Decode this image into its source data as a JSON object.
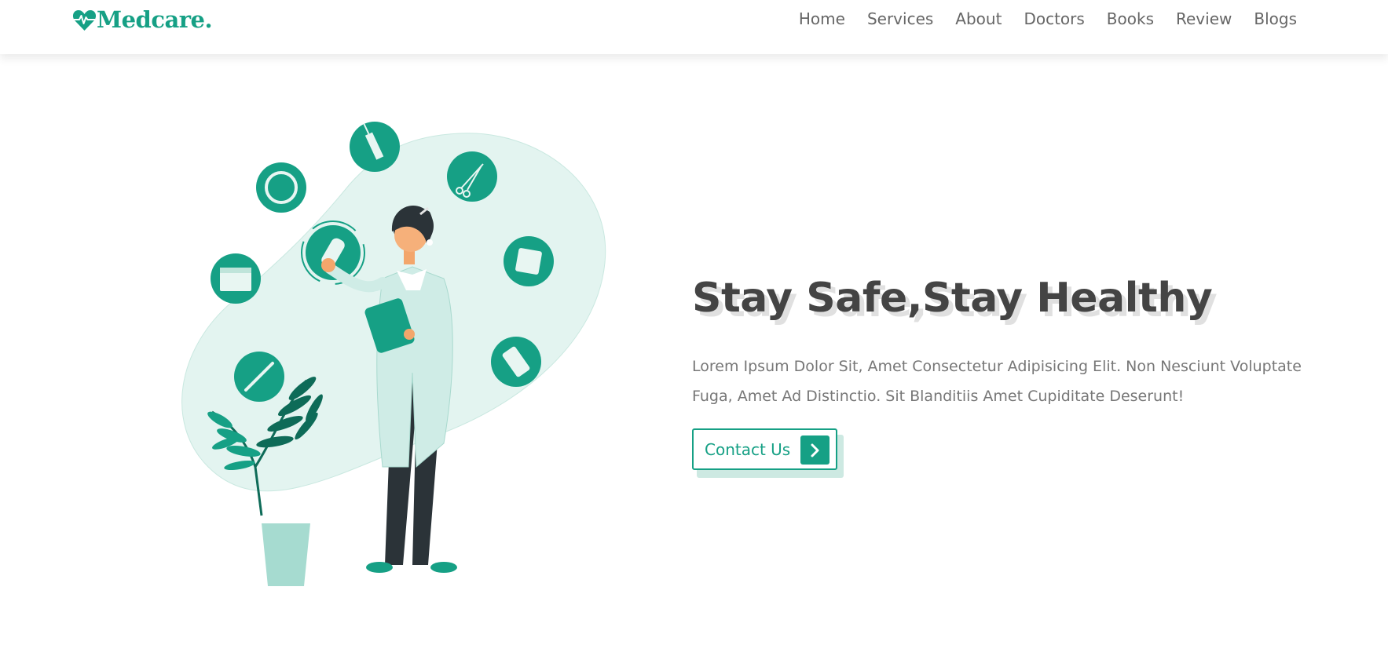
{
  "brand": {
    "name": "Medcare.",
    "logo_icon": "heart-pulse-icon",
    "color": "#16a085"
  },
  "nav": {
    "items": [
      {
        "label": "Home"
      },
      {
        "label": "Services"
      },
      {
        "label": "About"
      },
      {
        "label": "Doctors"
      },
      {
        "label": "Books"
      },
      {
        "label": "Review"
      },
      {
        "label": "Blogs"
      }
    ]
  },
  "hero": {
    "title": "Stay Safe,Stay Healthy",
    "description": "Lorem Ipsum Dolor Sit, Amet Consectetur Adipisicing Elit. Non Nesciunt Voluptate Fuga, Amet Ad Distinctio. Sit Blanditiis Amet Cupiditate Deserunt!",
    "button": {
      "label": "Contact Us",
      "icon": "chevron-right-icon"
    }
  },
  "colors": {
    "accent": "#16a085",
    "text_dark": "#444444",
    "text_muted": "#777777",
    "blob": "#e3f4f0"
  }
}
